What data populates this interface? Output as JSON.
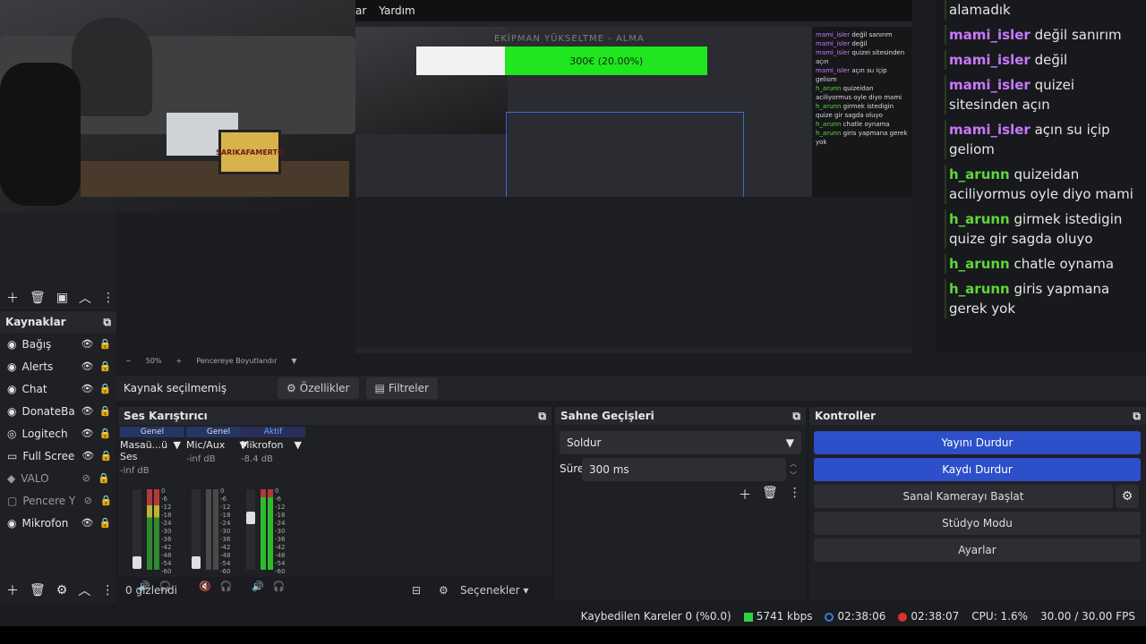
{
  "preview": {
    "menu_items": [
      "ar",
      "Yardım"
    ],
    "progress_title": "EKİPMAN YÜKSELTME - ALMA",
    "progress_label": "300€ (20.00%)",
    "progress_fraction": 0.2,
    "cam_overlay_text": "SARIKAFAMERTO"
  },
  "chat": {
    "messages": [
      {
        "user": "",
        "text": "alamadık",
        "color": "mami"
      },
      {
        "user": "mami_isler",
        "text": "değil sanırım",
        "color": "mami"
      },
      {
        "user": "mami_isler",
        "text": "değil",
        "color": "mami"
      },
      {
        "user": "mami_isler",
        "text": "quizei sitesinden açın",
        "color": "mami"
      },
      {
        "user": "mami_isler",
        "text": "açın su içip geliom",
        "color": "mami"
      },
      {
        "user": "h_arunn",
        "text": "quizeidan aciliyormus oyle diyo mami",
        "color": "harun"
      },
      {
        "user": "h_arunn",
        "text": "girmek istedigin quize gir sagda oluyo",
        "color": "harun"
      },
      {
        "user": "h_arunn",
        "text": "chatle oynama",
        "color": "harun"
      },
      {
        "user": "h_arunn",
        "text": "giris yapmana gerek yok",
        "color": "harun"
      }
    ]
  },
  "sources": {
    "title": "Kaynaklar",
    "items": [
      {
        "label": "Bağış",
        "icon": "browser-icon",
        "visible": true
      },
      {
        "label": "Alerts",
        "icon": "browser-icon",
        "visible": true
      },
      {
        "label": "Chat",
        "icon": "browser-icon",
        "visible": true
      },
      {
        "label": "DonateBa",
        "icon": "browser-icon",
        "visible": true
      },
      {
        "label": "Logitech",
        "icon": "camera-icon",
        "visible": true
      },
      {
        "label": "Full Scree",
        "icon": "monitor-icon",
        "visible": true
      },
      {
        "label": "VALO",
        "icon": "game-icon",
        "visible": false
      },
      {
        "label": "Pencere Y",
        "icon": "window-icon",
        "visible": false
      },
      {
        "label": "Mikrofon",
        "icon": "mic-icon",
        "visible": true
      }
    ]
  },
  "zoombar": {
    "minus": "−",
    "zoom": "50%",
    "plus": "+",
    "fit": "Pencereye Boyutlandır"
  },
  "propbar": {
    "label": "Kaynak seçilmemiş",
    "properties": "Özellikler",
    "filters": "Filtreler"
  },
  "mixer": {
    "title": "Ses Karıştırıcı",
    "channels": [
      {
        "status": "Genel",
        "name": "Masaü...ü Ses",
        "db": "-inf dB"
      },
      {
        "status": "Genel",
        "name": "Mic/Aux",
        "db": "-inf dB"
      },
      {
        "status": "Aktif",
        "name": "Mikrofon",
        "db": "-8.4 dB"
      }
    ],
    "scale": [
      "0",
      "-6",
      "-12",
      "-18",
      "-24",
      "-30",
      "-36",
      "-42",
      "-48",
      "-54",
      "-60"
    ],
    "hidden_label": "0 gizlendi",
    "options_label": "Seçenekler"
  },
  "transitions": {
    "title": "Sahne Geçişleri",
    "selected": "Soldur",
    "duration_label": "Süre",
    "duration_value": "300 ms"
  },
  "controls": {
    "title": "Kontroller",
    "stop_stream": "Yayını Durdur",
    "stop_record": "Kaydı Durdur",
    "virtual_cam": "Sanal Kamerayı Başlat",
    "studio_mode": "Stüdyo Modu",
    "settings": "Ayarlar"
  },
  "status": {
    "dropped": "Kaybedilen Kareler 0 (%0.0)",
    "bitrate": "5741 kbps",
    "stream_time": "02:38:06",
    "rec_time": "02:38:07",
    "cpu": "CPU: 1.6%",
    "fps": "30.00 / 30.00 FPS"
  },
  "colors": {
    "accent_blue": "#2d4fc9",
    "progress_green": "#1fe61f",
    "mami": "#c878ff",
    "harun": "#5fd63b"
  }
}
